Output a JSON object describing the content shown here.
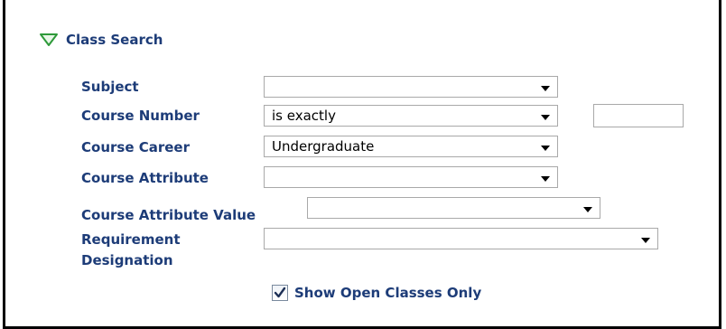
{
  "section": {
    "title": "Class Search",
    "expanded": true
  },
  "fields": {
    "subject": {
      "label": "Subject",
      "value": ""
    },
    "course_number": {
      "label": "Course Number",
      "operator": "is exactly",
      "value": ""
    },
    "course_career": {
      "label": "Course Career",
      "value": "Undergraduate"
    },
    "course_attribute": {
      "label": "Course Attribute",
      "value": ""
    },
    "course_attribute_value": {
      "label": "Course Attribute Value",
      "value": ""
    },
    "requirement_designation": {
      "label": "Requirement Designation",
      "value": ""
    }
  },
  "open_classes": {
    "label": "Show Open Classes Only",
    "checked": true
  },
  "colors": {
    "label": "#1d3c78",
    "triangle": "#2e9a3a",
    "border": "#a9a9a9"
  },
  "icons": {
    "expand": "triangle-down-icon",
    "dropdown": "chevron-down-icon",
    "check": "checkmark-icon"
  }
}
